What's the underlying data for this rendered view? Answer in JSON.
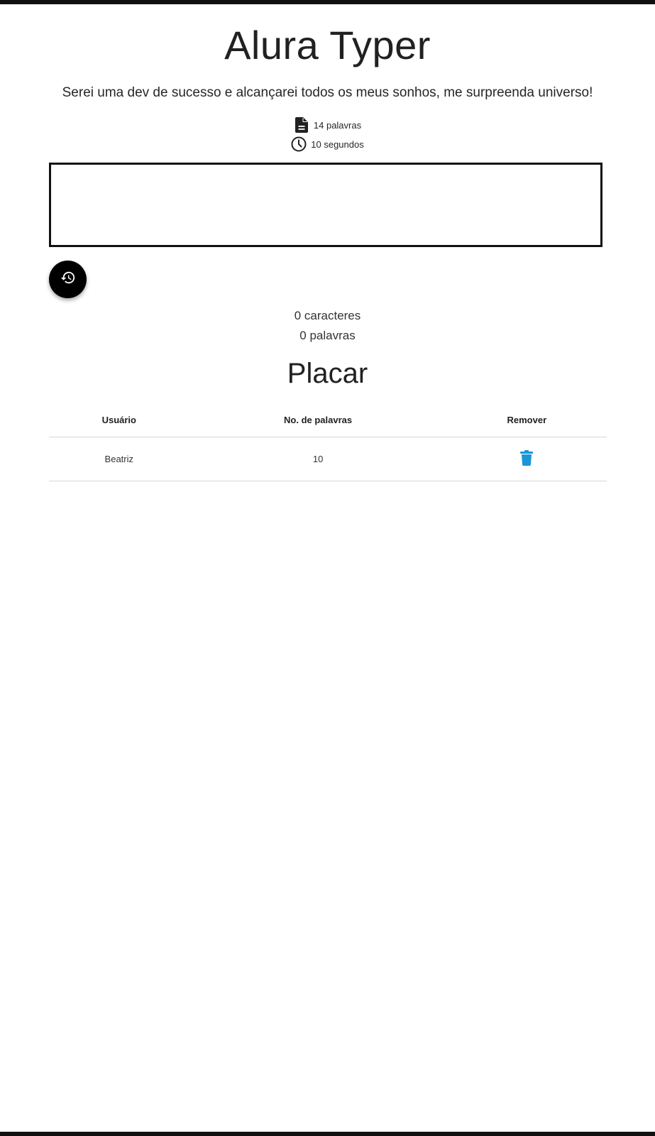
{
  "app": {
    "title": "Alura Typer",
    "phrase": "Serei uma dev de sucesso e alcançarei todos os meus sonhos, me surpreenda universo!"
  },
  "info": {
    "word_count": "14 palavras",
    "time_limit": "10 segundos",
    "words_icon": "document-icon",
    "time_icon": "clock-icon"
  },
  "typing": {
    "value": ""
  },
  "restart": {
    "icon": "history-icon"
  },
  "counters": {
    "characters": "0 caracteres",
    "words": "0 palavras"
  },
  "scoreboard": {
    "title": "Placar",
    "headers": {
      "user": "Usuário",
      "words": "No. de palavras",
      "remove": "Remover"
    },
    "rows": [
      {
        "user": "Beatriz",
        "words": "10",
        "remove_icon": "trash-icon"
      }
    ]
  },
  "colors": {
    "text": "#212121",
    "border": "#111111",
    "button_bg": "#000000",
    "trash": "#1a96d6",
    "divider": "#d6d6d6"
  }
}
